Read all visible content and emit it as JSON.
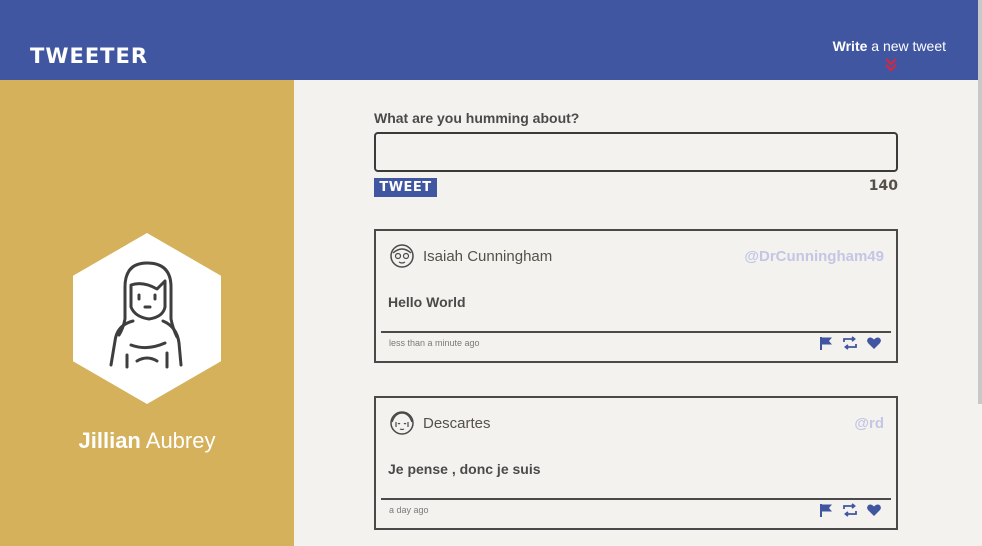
{
  "header": {
    "brand": "TWEETER",
    "compose_bold": "Write",
    "compose_rest": " a new tweet"
  },
  "profile": {
    "first_name": "Jillian",
    "last_name": " Aubrey"
  },
  "composer": {
    "label": "What are you humming about?",
    "placeholder": "",
    "button_label": "TWEET",
    "counter": "140"
  },
  "tweets": [
    {
      "author": "Isaiah Cunningham",
      "handle": "@DrCunningham49",
      "content": "Hello World",
      "time": "less than a minute ago"
    },
    {
      "author": "Descartes",
      "handle": "@rd",
      "content": "Je pense , donc je suis",
      "time": "a day ago"
    }
  ],
  "colors": {
    "header": "#4056a1",
    "sidebar": "#d4b15a",
    "background": "#f4f2ee",
    "accent_red": "#d7263d",
    "handle": "#c3c6e4"
  },
  "icons": [
    "double-chevron-down-icon",
    "user-avatar-icon",
    "flag-icon",
    "retweet-icon",
    "heart-icon"
  ]
}
